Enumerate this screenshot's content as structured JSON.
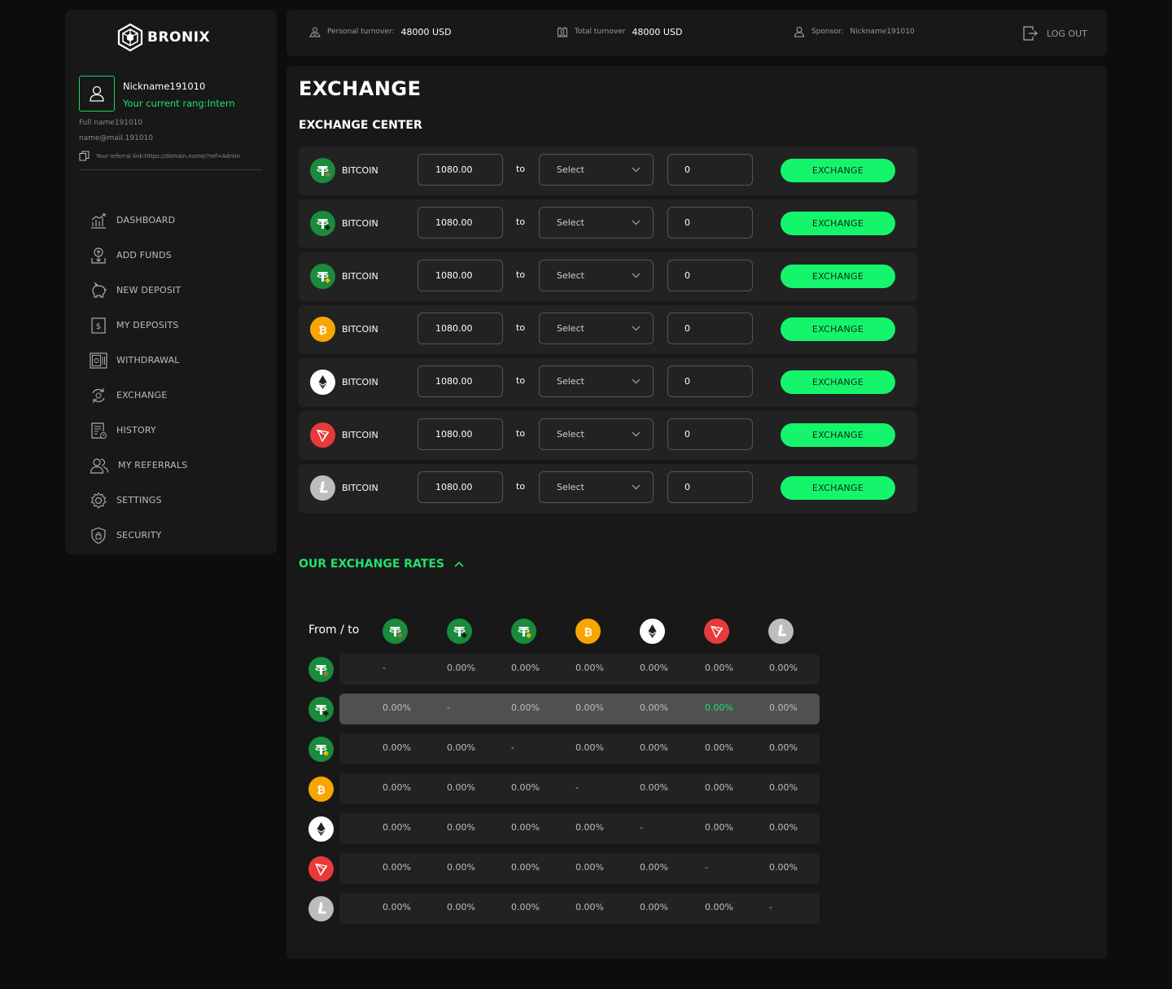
{
  "brand": {
    "name": "BRONIX"
  },
  "profile": {
    "nickname": "Nickname191010",
    "rang": "Your current rang:Intern",
    "full_name": "Full name191010",
    "email": "name@mail.191010",
    "referral": "Your referral link:https://domain.name/?ref=Admin"
  },
  "nav": [
    {
      "label": "DASHBOARD",
      "icon": "chart-icon"
    },
    {
      "label": "ADD FUNDS",
      "icon": "add-funds-icon"
    },
    {
      "label": "NEW DEPOSIT",
      "icon": "piggy-bank-icon"
    },
    {
      "label": "MY DEPOSITS",
      "icon": "dollar-icon"
    },
    {
      "label": "WITHDRAWAL",
      "icon": "withdrawal-icon"
    },
    {
      "label": "EXCHANGE",
      "icon": "exchange-icon"
    },
    {
      "label": "HISTORY",
      "icon": "history-icon"
    },
    {
      "label": "MY REFERRALS",
      "icon": "referrals-icon"
    },
    {
      "label": "SETTINGS",
      "icon": "gear-icon"
    },
    {
      "label": "SECURITY",
      "icon": "shield-icon"
    }
  ],
  "topbar": {
    "personal_label": "Personal turnover:",
    "personal_value": "48000 USD",
    "total_label": "Total turnover",
    "total_value": "48000 USD",
    "sponsor_label": "Sponsor:",
    "sponsor_value": "Nickname191010",
    "logout": "LOG OUT"
  },
  "page": {
    "title": "EXCHANGE",
    "section": "EXCHANGE CENTER"
  },
  "colors": {
    "accent": "#14f56c",
    "accent_text": "#22e06b",
    "panel": "#181818",
    "row": "#222222"
  },
  "coins": [
    {
      "id": "usdt-1",
      "bg": "#1a8a3c",
      "badge": "#9a7a3a"
    },
    {
      "id": "usdt-2",
      "bg": "#1a8a3c",
      "badge": "#1b1b1b"
    },
    {
      "id": "usdt-3",
      "bg": "#1a8a3c",
      "badge": "#f0b90b"
    },
    {
      "id": "btc",
      "bg": "#f7a600"
    },
    {
      "id": "eth",
      "bg": "#ffffff"
    },
    {
      "id": "trx",
      "bg": "#e83a3a"
    },
    {
      "id": "ltc",
      "bg": "#bdbdbd"
    }
  ],
  "exchange_rows": [
    {
      "name": "BITCOIN",
      "amount": "1080.00",
      "to": "to",
      "select": "Select",
      "result": "0",
      "button": "EXCHANGE"
    },
    {
      "name": "BITCOIN",
      "amount": "1080.00",
      "to": "to",
      "select": "Select",
      "result": "0",
      "button": "EXCHANGE"
    },
    {
      "name": "BITCOIN",
      "amount": "1080.00",
      "to": "to",
      "select": "Select",
      "result": "0",
      "button": "EXCHANGE"
    },
    {
      "name": "BITCOIN",
      "amount": "1080.00",
      "to": "to",
      "select": "Select",
      "result": "0",
      "button": "EXCHANGE"
    },
    {
      "name": "BITCOIN",
      "amount": "1080.00",
      "to": "to",
      "select": "Select",
      "result": "0",
      "button": "EXCHANGE"
    },
    {
      "name": "BITCOIN",
      "amount": "1080.00",
      "to": "to",
      "select": "Select",
      "result": "0",
      "button": "EXCHANGE"
    },
    {
      "name": "BITCOIN",
      "amount": "1080.00",
      "to": "to",
      "select": "Select",
      "result": "0",
      "button": "EXCHANGE"
    }
  ],
  "rates": {
    "title": "OUR EXCHANGE RATES",
    "header": "From / to",
    "highlight_row": 1,
    "highlight_col": 5,
    "matrix": [
      [
        "-",
        "0.00%",
        "0.00%",
        "0.00%",
        "0.00%",
        "0.00%",
        "0.00%"
      ],
      [
        "0.00%",
        "-",
        "0.00%",
        "0.00%",
        "0.00%",
        "0.00%",
        "0.00%"
      ],
      [
        "0.00%",
        "0.00%",
        "-",
        "0.00%",
        "0.00%",
        "0.00%",
        "0.00%"
      ],
      [
        "0.00%",
        "0.00%",
        "0.00%",
        "-",
        "0.00%",
        "0.00%",
        "0.00%"
      ],
      [
        "0.00%",
        "0.00%",
        "0.00%",
        "0.00%",
        "-",
        "0.00%",
        "0.00%"
      ],
      [
        "0.00%",
        "0.00%",
        "0.00%",
        "0.00%",
        "0.00%",
        "-",
        "0.00%"
      ],
      [
        "0.00%",
        "0.00%",
        "0.00%",
        "0.00%",
        "0.00%",
        "0.00%",
        "-"
      ]
    ]
  }
}
